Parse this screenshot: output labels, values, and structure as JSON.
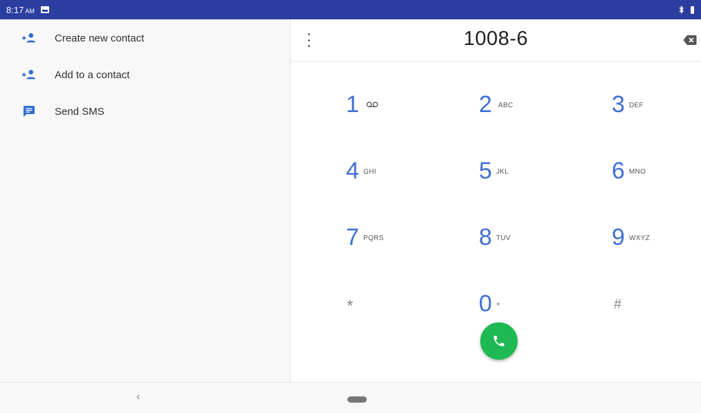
{
  "status_bar": {
    "time": "8:17",
    "ampm": "AM",
    "icons": [
      "image-notification-icon",
      "bluetooth-icon",
      "battery-icon"
    ]
  },
  "left_panel": {
    "items": [
      {
        "label": "Create new contact",
        "icon": "add-person-icon"
      },
      {
        "label": "Add to a contact",
        "icon": "add-person-icon"
      },
      {
        "label": "Send SMS",
        "icon": "message-icon"
      }
    ]
  },
  "dialpad": {
    "number": "1008-6",
    "keys": [
      {
        "digit": "1",
        "letters": "",
        "icon": "voicemail-icon"
      },
      {
        "digit": "2",
        "letters": "ABC"
      },
      {
        "digit": "3",
        "letters": "DEF"
      },
      {
        "digit": "4",
        "letters": "GHI"
      },
      {
        "digit": "5",
        "letters": "JKL"
      },
      {
        "digit": "6",
        "letters": "MNO"
      },
      {
        "digit": "7",
        "letters": "PQRS"
      },
      {
        "digit": "8",
        "letters": "TUV"
      },
      {
        "digit": "9",
        "letters": "WXYZ"
      },
      {
        "digit": "*",
        "letters": ""
      },
      {
        "digit": "0",
        "letters": "+"
      },
      {
        "digit": "#",
        "letters": ""
      }
    ]
  },
  "nav_bar": {
    "back_symbol": "‹"
  },
  "colors": {
    "status_bar": "#2b3ea0",
    "accent_blue": "#3f6fd6",
    "call_green": "#1fb954"
  }
}
